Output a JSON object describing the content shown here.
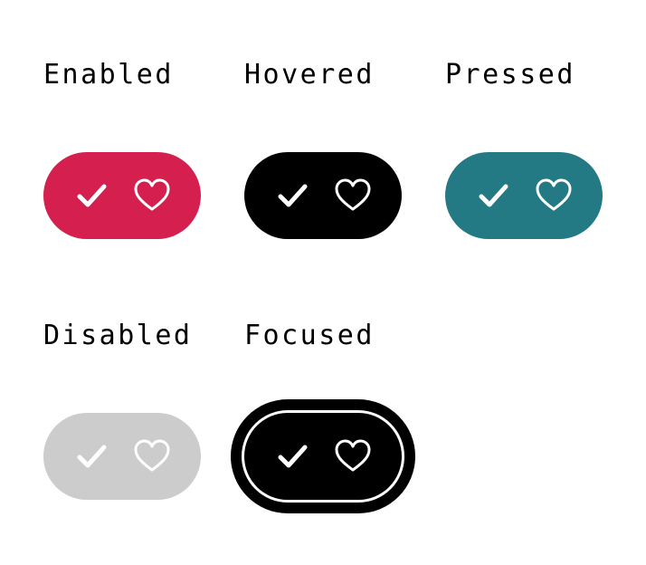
{
  "states": [
    {
      "key": "enabled",
      "label": "Enabled",
      "bg": "#d41f4f"
    },
    {
      "key": "hovered",
      "label": "Hovered",
      "bg": "#000000"
    },
    {
      "key": "pressed",
      "label": "Pressed",
      "bg": "#237a85"
    },
    {
      "key": "disabled",
      "label": "Disabled",
      "bg": "#cccccc"
    },
    {
      "key": "focused",
      "label": "Focused",
      "bg": "#000000"
    }
  ],
  "icons": [
    "check-icon",
    "heart-outline-icon"
  ],
  "colors": {
    "icon": "#ffffff",
    "focus_ring": "#000000",
    "background": "#ffffff"
  }
}
